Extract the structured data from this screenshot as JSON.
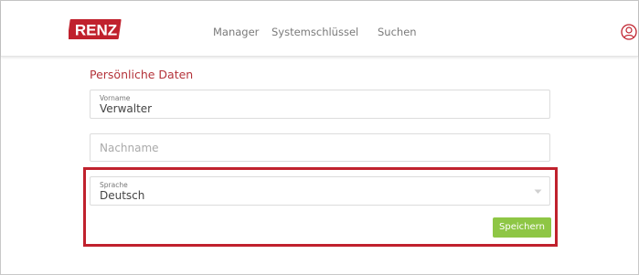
{
  "header": {
    "logo": {
      "text": "RENZ",
      "color": "#c0212d"
    },
    "nav": [
      {
        "label": "Manager"
      },
      {
        "label": "Systemschlüssel"
      },
      {
        "label": "Suchen"
      }
    ],
    "user_icon": "user-icon"
  },
  "form": {
    "section_title": "Persönliche Daten",
    "vorname": {
      "label": "Vorname",
      "value": "Verwalter"
    },
    "nachname": {
      "placeholder": "Nachname",
      "value": ""
    },
    "sprache": {
      "label": "Sprache",
      "selected": "Deutsch"
    },
    "save_label": "Speichern"
  },
  "colors": {
    "accent_red": "#c0212d",
    "button_green": "#8ec645",
    "section_title": "#b4333a"
  }
}
